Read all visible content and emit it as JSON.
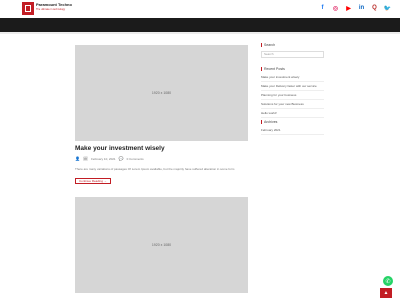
{
  "brand": {
    "name": "Paramount Techno",
    "tagline": "The ultimate in technology"
  },
  "social": [
    {
      "icon": "facebook-icon",
      "glyph": "f",
      "color": "#1877f2"
    },
    {
      "icon": "instagram-icon",
      "glyph": "◎",
      "color": "#e1306c"
    },
    {
      "icon": "youtube-icon",
      "glyph": "▶",
      "color": "#ff0000"
    },
    {
      "icon": "linkedin-icon",
      "glyph": "in",
      "color": "#0a66c2"
    },
    {
      "icon": "quora-icon",
      "glyph": "Q",
      "color": "#b92b27"
    },
    {
      "icon": "twitter-icon",
      "glyph": "🐦",
      "color": "#1da1f2"
    }
  ],
  "posts": [
    {
      "thumb_label": "1920 x 1080",
      "title": "Make your investment wisely",
      "date": "February 10, 2021",
      "comments": "0 Comments",
      "excerpt": "There are many variations of passages Of Lorem Ipsum available, but the majority have suffered alteration in some form",
      "read_more": "Continue Reading →"
    },
    {
      "thumb_label": "1920 x 1080"
    }
  ],
  "sidebar": {
    "search": {
      "heading": "Search",
      "placeholder": "Search"
    },
    "recent": {
      "heading": "Recent Posts",
      "items": [
        "Make your investment wisely",
        "Make your Delivery faster with our service",
        "Planning for your business",
        "Solutions for your new Business",
        "Hello world!"
      ]
    },
    "archives": {
      "heading": "Archives",
      "items": [
        "February 2021"
      ]
    }
  },
  "colors": {
    "accent": "#c21d24",
    "nav": "#1b1b1b",
    "thumb": "#d6d6d6"
  }
}
